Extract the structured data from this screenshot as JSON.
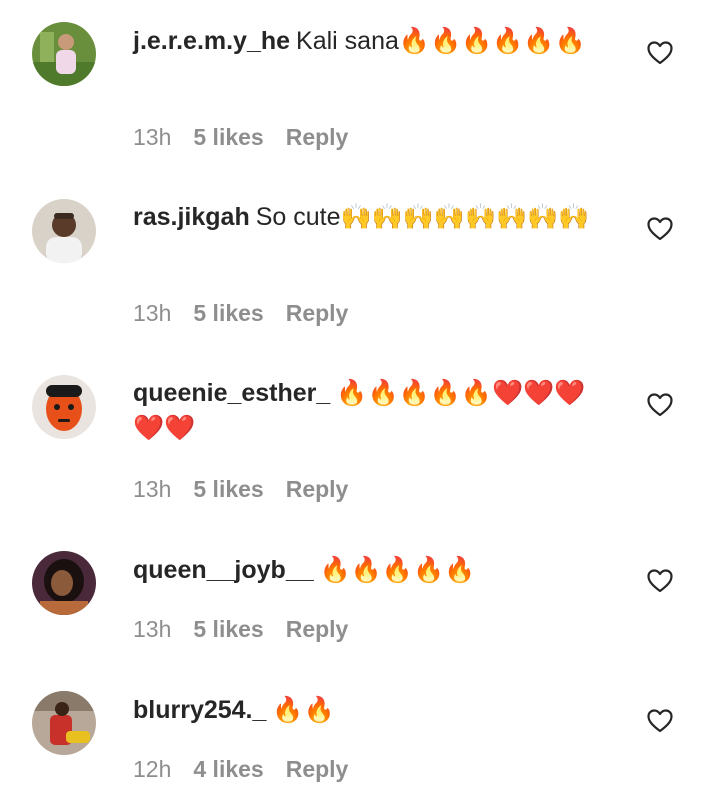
{
  "comments": [
    {
      "username": "j.e.r.e.m.y_he",
      "text": "Kali sana🔥🔥🔥🔥🔥🔥",
      "time": "13h",
      "likes": "5 likes",
      "reply": "Reply",
      "avatar": {
        "bg": "#6a8f3c",
        "fg": "#f0d8e8"
      }
    },
    {
      "username": "ras.jikgah",
      "text": "So cute🙌🙌🙌🙌🙌🙌🙌🙌",
      "time": "13h",
      "likes": "5 likes",
      "reply": "Reply",
      "avatar": {
        "bg": "#d9d2c8",
        "fg": "#3a2a20"
      }
    },
    {
      "username": "queenie_esther_",
      "text": "🔥🔥🔥🔥🔥❤️❤️❤️❤️❤️",
      "time": "13h",
      "likes": "5 likes",
      "reply": "Reply",
      "avatar": {
        "bg": "#e9e4df",
        "fg": "#e8501a"
      }
    },
    {
      "username": "queen__joyb__",
      "text": "🔥🔥🔥🔥🔥",
      "time": "13h",
      "likes": "5 likes",
      "reply": "Reply",
      "avatar": {
        "bg": "#4a2a3a",
        "fg": "#b86a3a"
      }
    },
    {
      "username": "blurry254._",
      "text": "🔥🔥",
      "time": "12h",
      "likes": "4 likes",
      "reply": "Reply",
      "avatar": {
        "bg": "#b8a89a",
        "fg": "#c8302a"
      }
    }
  ],
  "icons": {
    "like": "heart-outline-icon"
  }
}
